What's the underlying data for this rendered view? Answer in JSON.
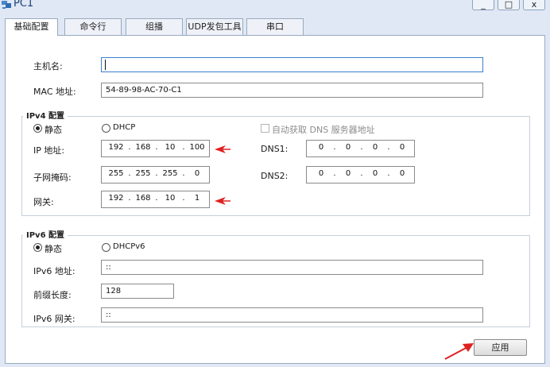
{
  "window": {
    "title": "PC1",
    "icon": "pc-icon",
    "controls": {
      "minimize": "_",
      "maximize": "□",
      "close": "x"
    }
  },
  "tabs": [
    {
      "label": "基础配置",
      "active": true
    },
    {
      "label": "命令行",
      "active": false
    },
    {
      "label": "组播",
      "active": false
    },
    {
      "label": "UDP发包工具",
      "active": false
    },
    {
      "label": "串口",
      "active": false
    }
  ],
  "basic": {
    "hostname_label": "主机名:",
    "hostname_value": "",
    "mac_label": "MAC 地址:",
    "mac_value": "54-89-98-AC-70-C1"
  },
  "ipv4": {
    "title": "IPv4 配置",
    "static_label": "静态",
    "dhcp_label": "DHCP",
    "mode": "static",
    "auto_dns_label": "自动获取 DNS 服务器地址",
    "auto_dns_checked": false,
    "ip_label": "IP 地址:",
    "ip": [
      "192",
      "168",
      "10",
      "100"
    ],
    "mask_label": "子网掩码:",
    "mask": [
      "255",
      "255",
      "255",
      "0"
    ],
    "gateway_label": "网关:",
    "gateway": [
      "192",
      "168",
      "10",
      "1"
    ],
    "dns1_label": "DNS1:",
    "dns1": [
      "0",
      "0",
      "0",
      "0"
    ],
    "dns2_label": "DNS2:",
    "dns2": [
      "0",
      "0",
      "0",
      "0"
    ],
    "dot": "."
  },
  "ipv6": {
    "title": "IPv6 配置",
    "static_label": "静态",
    "dhcp_label": "DHCPv6",
    "mode": "static",
    "address_label": "IPv6 地址:",
    "address_value": "::",
    "prefix_label": "前缀长度:",
    "prefix_value": "128",
    "gateway_label": "IPv6 网关:",
    "gateway_value": "::"
  },
  "apply_label": "应用",
  "colors": {
    "annotation_arrow": "#e02020",
    "focus_border": "#3c7fd0",
    "window_bg": "#dfe8f4"
  }
}
